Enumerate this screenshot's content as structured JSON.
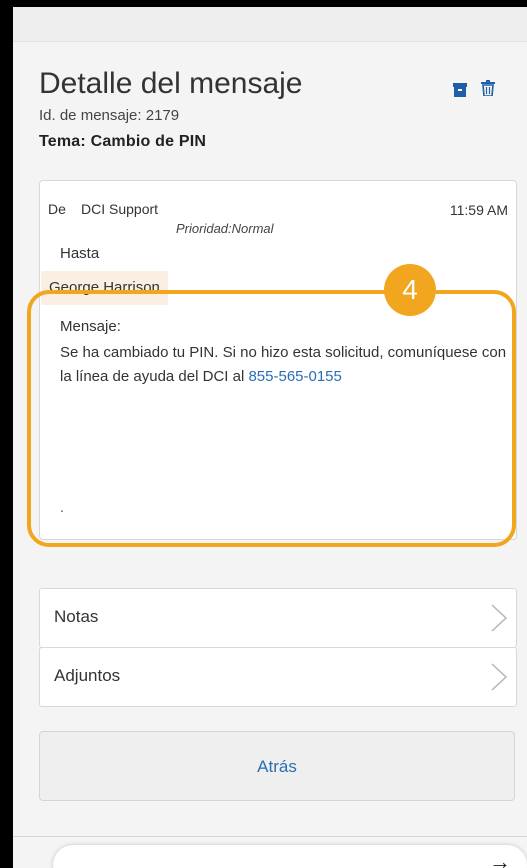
{
  "header": {
    "title": "Detalle del mensaje",
    "message_id": "Id. de mensaje: 2179",
    "subject": "Tema: Cambio de PIN",
    "icons": {
      "archive": "archive-icon",
      "delete": "trash-icon"
    }
  },
  "message": {
    "from_label": "De",
    "from_value": "DCI Support",
    "time": "11:59 AM",
    "priority": "Prioridad:Normal",
    "to_label": "Hasta",
    "recipient": "George Harrison",
    "body_label": "Mensaje:",
    "body_text": "Se ha cambiado tu PIN. Si no hizo esta solicitud, comuníquese con la línea de ayuda del DCI al ",
    "phone": "855-565-0155",
    "trailing": "."
  },
  "annotation": {
    "step": "4",
    "color": "#f2a51f"
  },
  "sections": [
    {
      "label": "Notas"
    },
    {
      "label": "Adjuntos"
    }
  ],
  "back_button": {
    "label": "Atrás"
  },
  "colors": {
    "link": "#2a6eb3",
    "recipient_bg": "#fbeee2",
    "page_bg": "#f4f4f4"
  }
}
